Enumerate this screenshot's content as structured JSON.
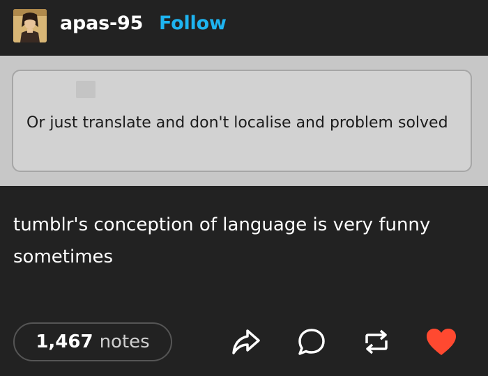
{
  "header": {
    "username": "apas-95",
    "follow_label": "Follow"
  },
  "quote": {
    "text": "Or just translate and don't localise and problem solved"
  },
  "post": {
    "text": "tumblr's conception of language is very funny sometimes"
  },
  "footer": {
    "notes_count": "1,467",
    "notes_label": "notes",
    "icons": [
      "share-icon",
      "reply-icon",
      "reblog-icon",
      "like-heart-icon"
    ]
  },
  "colors": {
    "background": "#222222",
    "follow_accent": "#1eb4f0",
    "like_red": "#ff4930",
    "quote_band": "#c7c7c7"
  }
}
